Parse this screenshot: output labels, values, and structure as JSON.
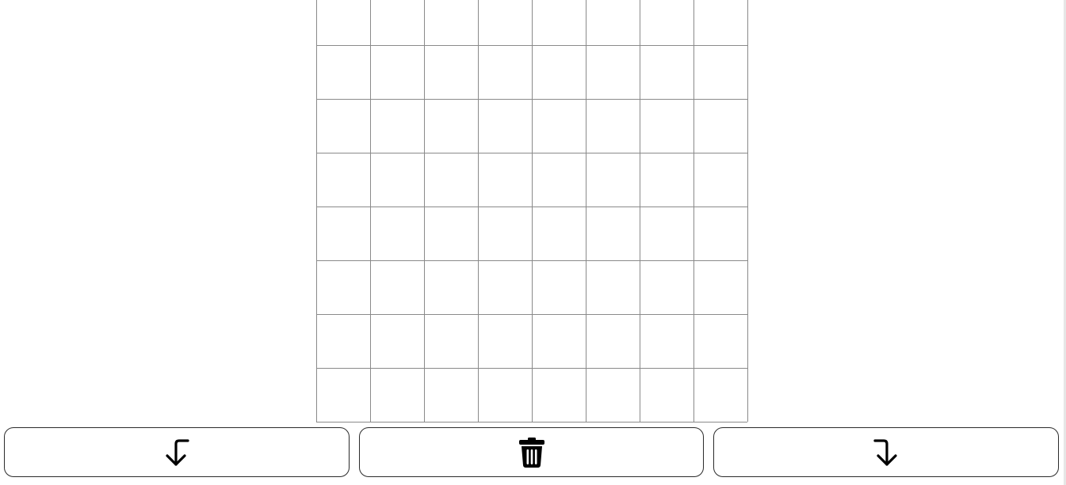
{
  "grid": {
    "rows": 8,
    "cols": 8,
    "line_color": "#8a8a8a",
    "cell_color": "#ffffff"
  },
  "toolbar": {
    "buttons": [
      {
        "id": "undo",
        "icon": "arrow-turn-down-left-icon"
      },
      {
        "id": "clear",
        "icon": "trash-icon"
      },
      {
        "id": "redo",
        "icon": "arrow-turn-down-right-icon"
      }
    ],
    "border_color": "#2b2b2b",
    "icon_color": "#000000"
  }
}
